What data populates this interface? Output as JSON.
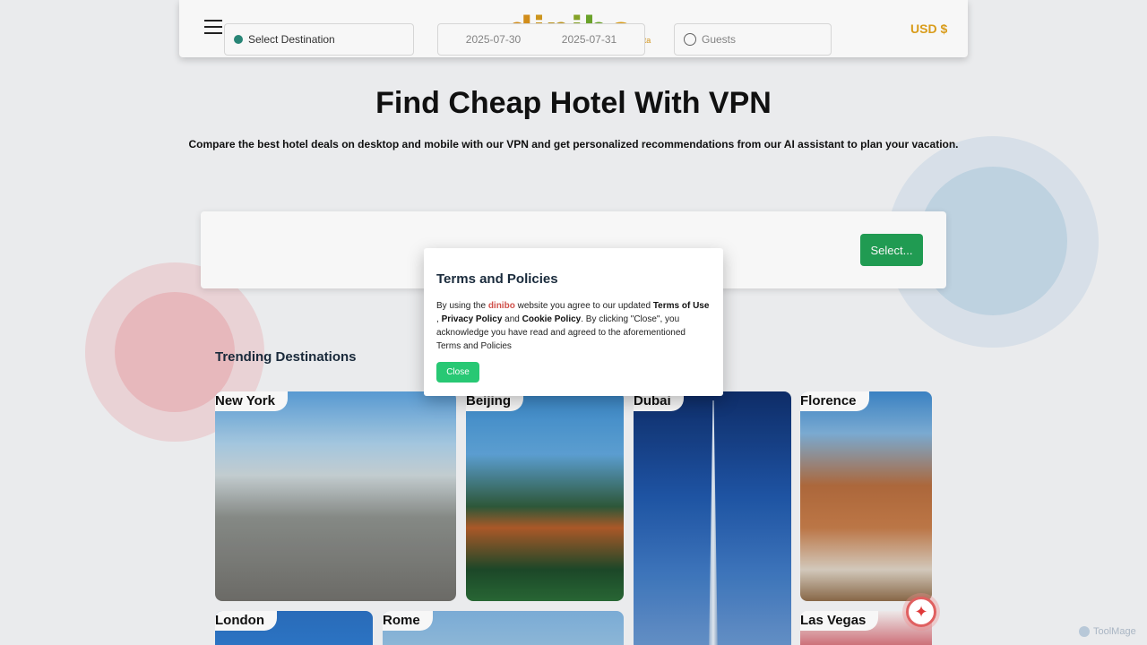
{
  "header": {
    "logo_text": "dinibo",
    "logo_beta": "beta",
    "currency": "USD $",
    "logo_letters": [
      {
        "ch": "d",
        "color": "#d8921c"
      },
      {
        "ch": "i",
        "color": "#d39a1f"
      },
      {
        "ch": "n",
        "color": "#c39a24"
      },
      {
        "ch": "i",
        "color": "#8aa82a"
      },
      {
        "ch": "b",
        "color": "#6ea82b"
      },
      {
        "ch": "o",
        "color": "#e0a21c"
      }
    ]
  },
  "hero": {
    "title": "Find Cheap Hotel With VPN",
    "subtitle": "Compare the best hotel deals on desktop and mobile with our VPN and get personalized recommendations from our AI assistant to plan your vacation."
  },
  "search": {
    "destination_placeholder": "Select Destination",
    "checkin": "2025-07-30",
    "checkout": "2025-07-31",
    "guests_placeholder": "Guests",
    "select_label": "Select..."
  },
  "trending": {
    "title": "Trending Destinations",
    "destinations": [
      "New York",
      "Beijing",
      "Dubai",
      "Florence",
      "London",
      "Rome",
      "Las Vegas"
    ]
  },
  "modal": {
    "title": "Terms and Policies",
    "text_1": "By using the ",
    "brand": "dinibo",
    "text_2": " website you agree to our updated ",
    "terms_of_use": "Terms of Use",
    "text_3": ", ",
    "privacy_policy": "Privacy Policy",
    "text_4": " and ",
    "cookie_policy": "Cookie Policy",
    "text_5": ". By clicking \"Close\", you acknowledge you have read and agreed to the aforementioned Terms and Policies",
    "close_label": "Close"
  },
  "widgets": {
    "assistant_icon": "sparkle-icon",
    "watermark": "ToolMage"
  }
}
